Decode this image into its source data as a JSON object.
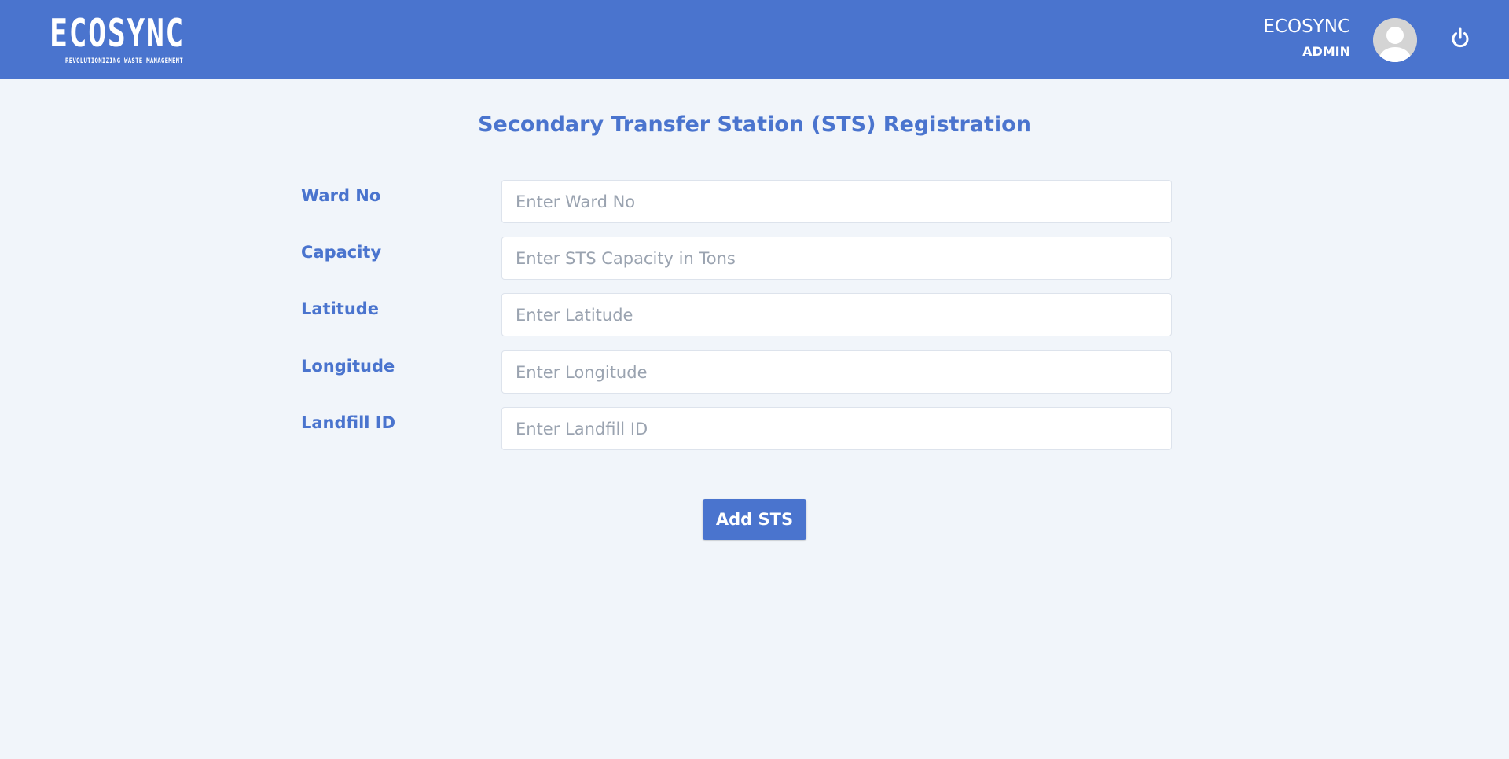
{
  "header": {
    "logo_text": "ECOSYNC",
    "logo_tagline": "REVOLUTIONIZING WASTE MANAGEMENT",
    "user_name": "ECOSYNC",
    "user_role": "ADMIN",
    "avatar_icon": "user-avatar-icon",
    "logout_icon": "power-icon",
    "bg_color": "#4a74ce"
  },
  "page": {
    "title": "Secondary Transfer Station (STS) Registration"
  },
  "form": {
    "fields": [
      {
        "label": "Ward No",
        "placeholder": "Enter Ward No",
        "value": ""
      },
      {
        "label": "Capacity",
        "placeholder": "Enter STS Capacity in Tons",
        "value": ""
      },
      {
        "label": "Latitude",
        "placeholder": "Enter Latitude",
        "value": ""
      },
      {
        "label": "Longitude",
        "placeholder": "Enter Longitude",
        "value": ""
      },
      {
        "label": "Landfill ID",
        "placeholder": "Enter Landfill ID",
        "value": ""
      }
    ],
    "submit_label": "Add STS"
  },
  "colors": {
    "accent": "#4a74ce",
    "background": "#f1f5fa"
  }
}
